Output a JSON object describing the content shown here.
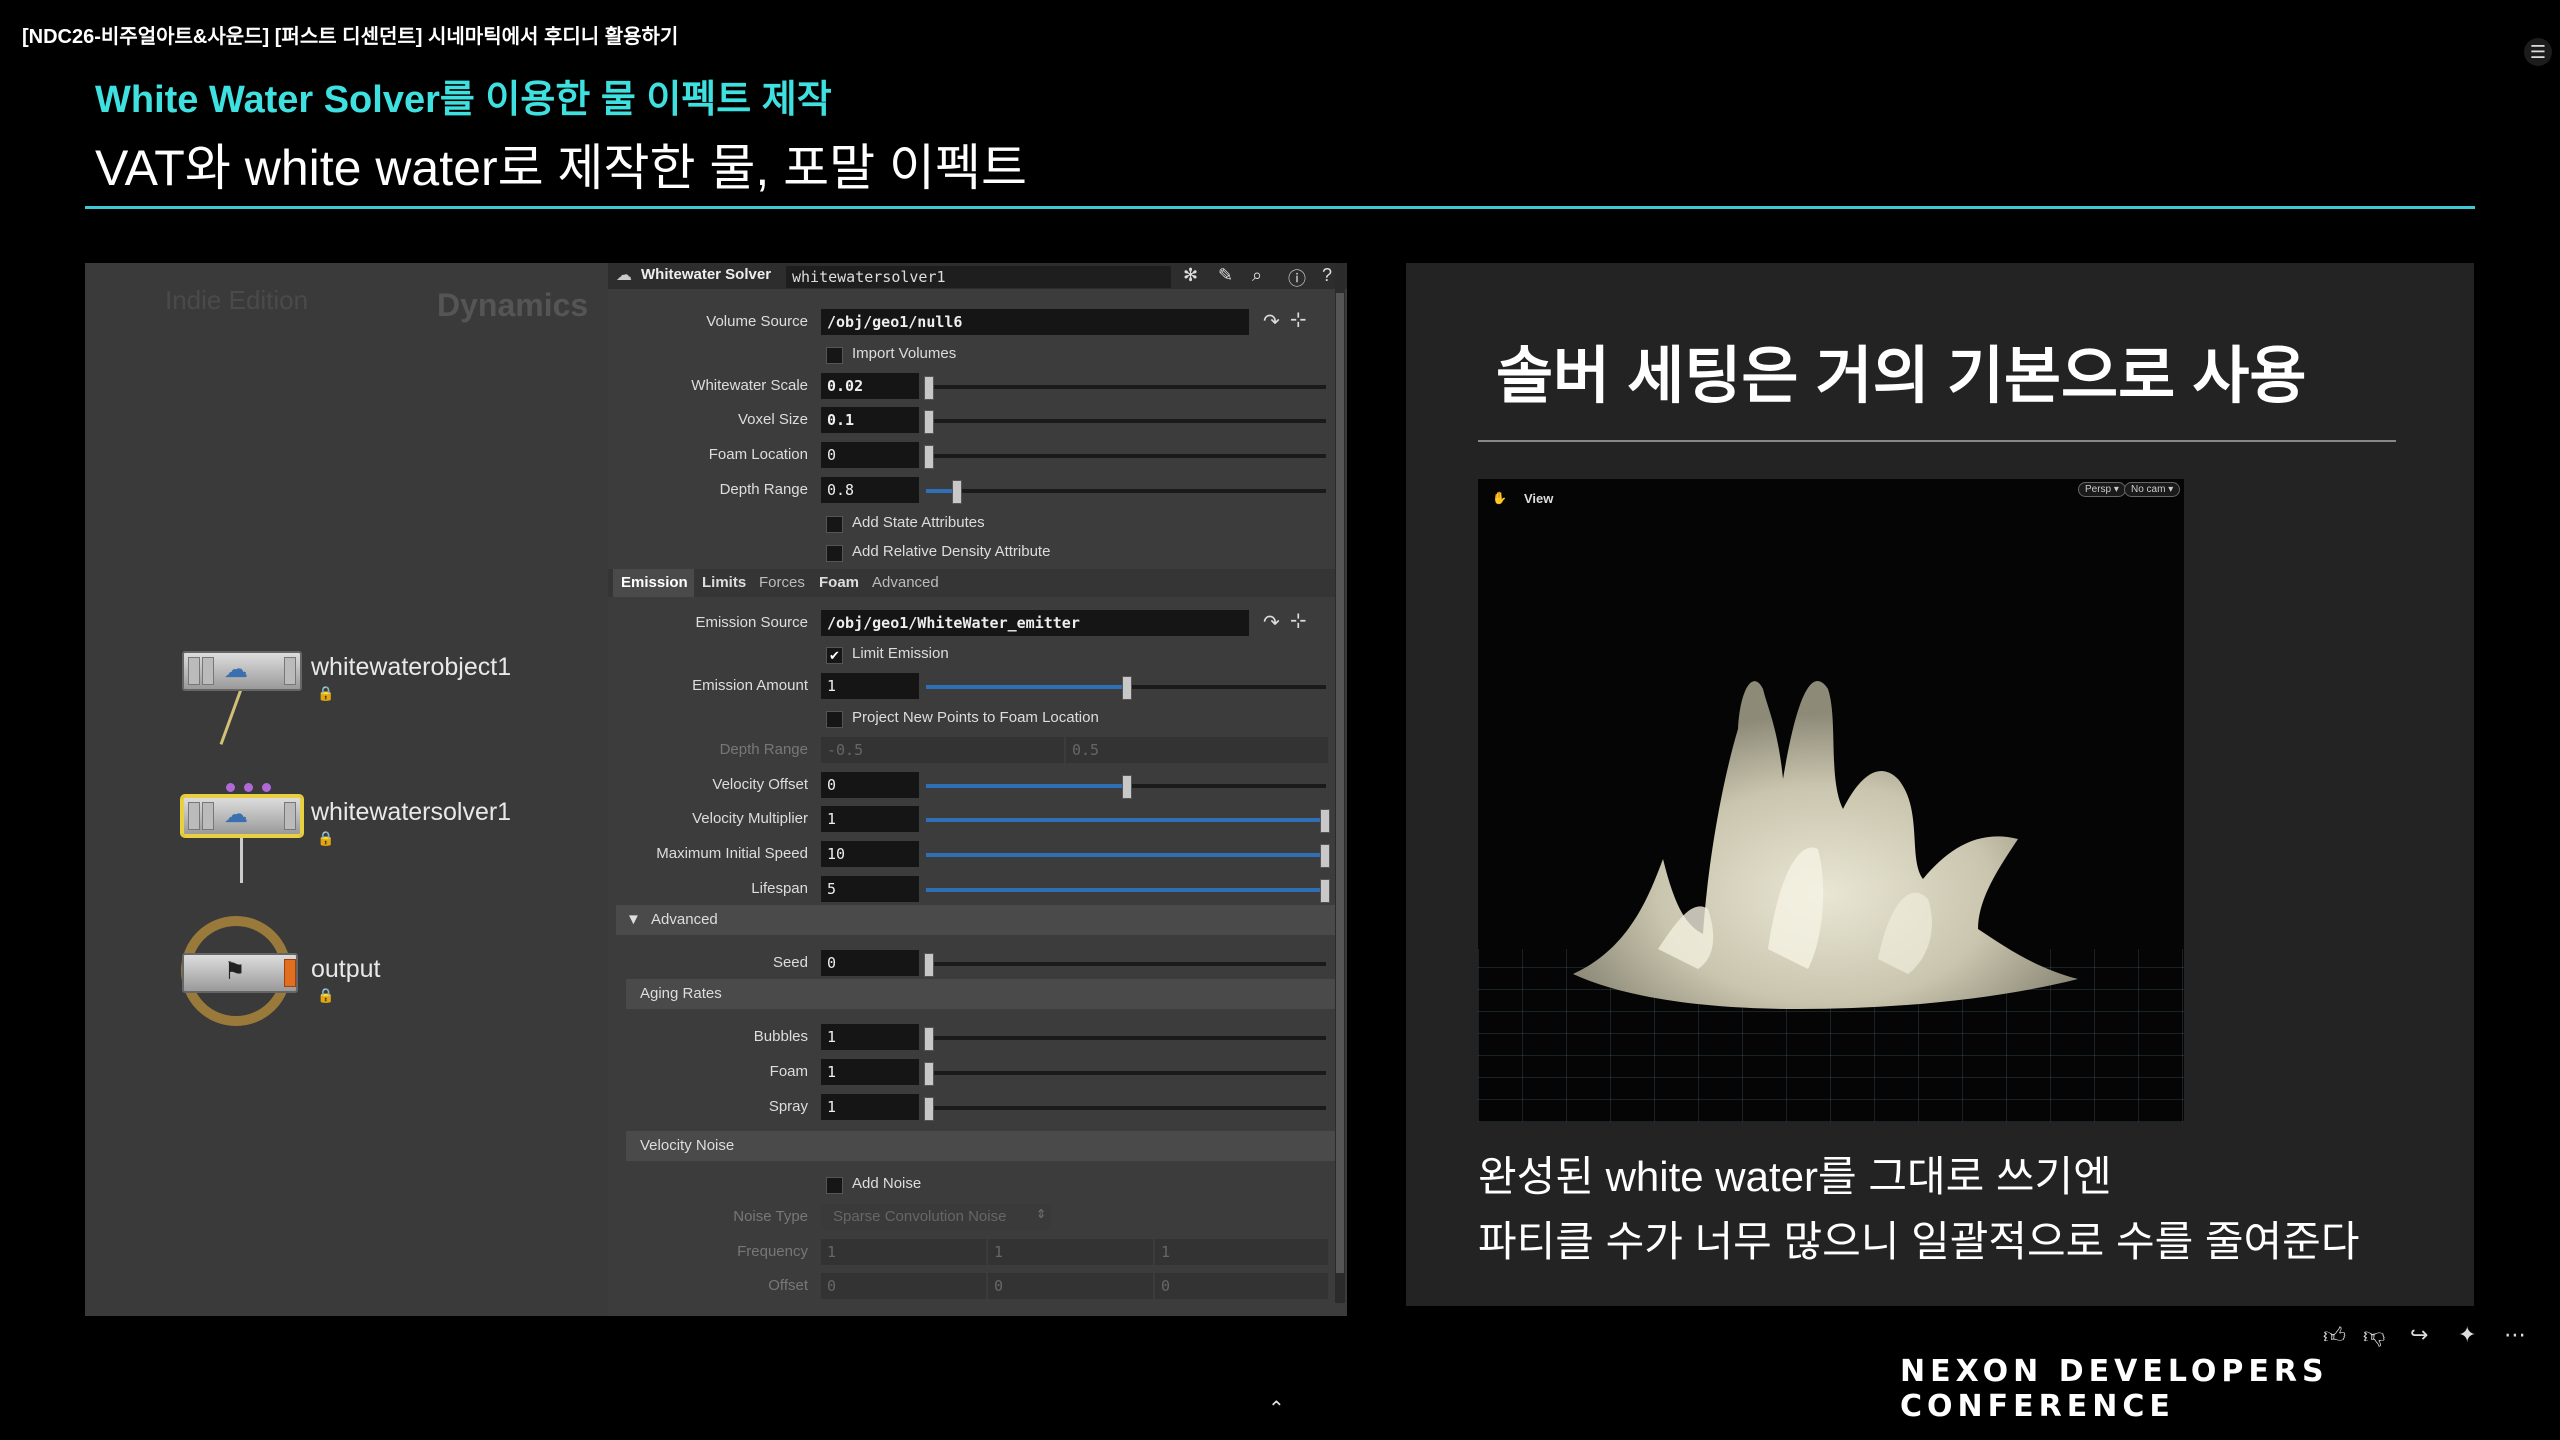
{
  "video": {
    "title": "[NDC26-비주얼아트&사운드] [퍼스트 디센던트] 시네마틱에서 후디니 활용하기",
    "menu_icon": "hamburger-menu-icon"
  },
  "slide": {
    "subtitle": "White Water Solver를 이용한 물 이펙트 제작",
    "title": "VAT와 white water로 제작한 물, 포말 이펙트",
    "accent_color": "#3ee0e0"
  },
  "network": {
    "edition": "Indie Edition",
    "context": "Dynamics",
    "nodes": [
      {
        "name": "whitewaterobject1"
      },
      {
        "name": "whitewatersolver1"
      },
      {
        "name": "output"
      }
    ]
  },
  "params": {
    "op_type": "Whitewater Solver",
    "node_name": "whitewatersolver1",
    "volume_source": {
      "label": "Volume Source",
      "value": "/obj/geo1/null6"
    },
    "import_volumes": "Import Volumes",
    "whitewater_scale": {
      "label": "Whitewater Scale",
      "value": "0.02"
    },
    "voxel_size": {
      "label": "Voxel Size",
      "value": "0.1"
    },
    "foam_location": {
      "label": "Foam Location",
      "value": "0"
    },
    "depth_range_top": {
      "label": "Depth Range",
      "value": "0.8"
    },
    "add_state_attributes": "Add State Attributes",
    "add_relative_density": "Add Relative Density Attribute",
    "tabs": [
      "Emission",
      "Limits",
      "Forces",
      "Foam",
      "Advanced"
    ],
    "emission_source": {
      "label": "Emission Source",
      "value": "/obj/geo1/WhiteWater_emitter"
    },
    "limit_emission": "Limit Emission",
    "emission_amount": {
      "label": "Emission Amount",
      "value": "1"
    },
    "project_new_points": "Project New Points to Foam Location",
    "depth_range": {
      "label": "Depth Range",
      "v1": "-0.5",
      "v2": "0.5"
    },
    "velocity_offset": {
      "label": "Velocity Offset",
      "value": "0"
    },
    "velocity_multiplier": {
      "label": "Velocity Multiplier",
      "value": "1"
    },
    "max_initial_speed": {
      "label": "Maximum Initial Speed",
      "value": "10"
    },
    "lifespan": {
      "label": "Lifespan",
      "value": "5"
    },
    "advanced_folder": "Advanced",
    "seed": {
      "label": "Seed",
      "value": "0"
    },
    "aging_rates": "Aging Rates",
    "bubbles": {
      "label": "Bubbles",
      "value": "1"
    },
    "foam": {
      "label": "Foam",
      "value": "1"
    },
    "spray": {
      "label": "Spray",
      "value": "1"
    },
    "velocity_noise": "Velocity Noise",
    "add_noise": "Add Noise",
    "noise_type": {
      "label": "Noise Type",
      "value": "Sparse Convolution Noise"
    },
    "frequency": {
      "label": "Frequency",
      "v1": "1",
      "v2": "1",
      "v3": "1"
    },
    "offset": {
      "label": "Offset",
      "v1": "0",
      "v2": "0",
      "v3": "0"
    }
  },
  "right": {
    "heading": "솔버 세팅은 거의 기본으로 사용",
    "viewport": {
      "label": "View",
      "persp": "Persp ▾",
      "cam": "No cam ▾"
    },
    "caption_line1": "완성된 white water를 그대로 쓰기엔",
    "caption_line2": "파티클 수가 너무 많으니 일괄적으로 수를 줄여준다"
  },
  "footer": {
    "logo": "NEXON DEVELOPERS CONFERENCE",
    "icons": [
      "thumbs-up-icon",
      "thumbs-down-icon",
      "share-icon",
      "sparkle-icon",
      "more-icon"
    ]
  }
}
